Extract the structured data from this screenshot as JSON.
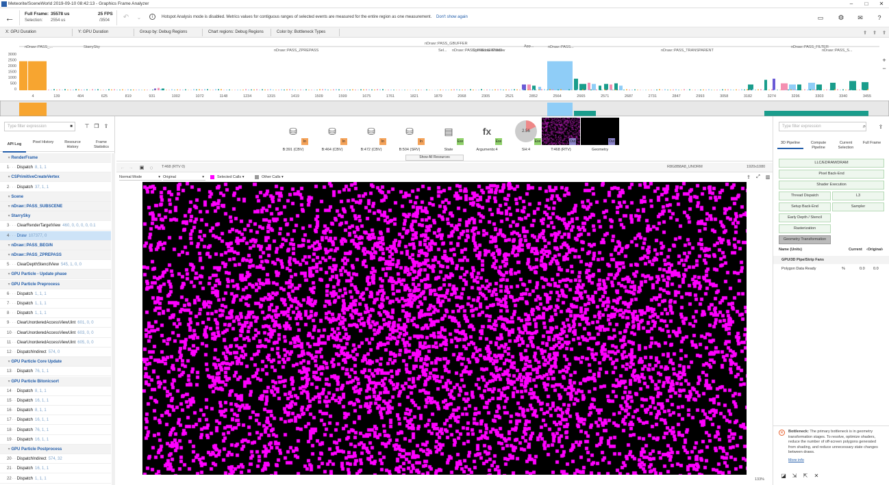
{
  "titlebar": {
    "title": "Meteorite/SceneWorld 2019-09-10 08:42:13 - Graphics Frame Analyzer"
  },
  "header": {
    "full_frame_label": "Full Frame:",
    "full_frame_value": "35578 us",
    "fps": "25 FPS",
    "selection_label": "Selection:",
    "selection_value": "2554 us",
    "selection_count": "/3504",
    "info_text": "Hotspot Analysis mode is disabled. Metrics values for contiguous ranges of selected events are measured for the entire region as one measurement.",
    "dont_show_again": "Don't show again"
  },
  "filters": [
    {
      "label": "X: GPU Duration"
    },
    {
      "label": "Y: GPU Duration"
    },
    {
      "label": "Group by: Debug Regions"
    },
    {
      "label": "Chart regions: Debug Regions"
    },
    {
      "label": "Color by: Bottleneck Types"
    }
  ],
  "timeline": {
    "y_ticks": [
      "3000",
      "2500",
      "2000",
      "1500",
      "1000",
      "500",
      "0"
    ],
    "x_ticks": [
      "4",
      "139",
      "404",
      "625",
      "819",
      "931",
      "1002",
      "1072",
      "1148",
      "1234",
      "1315",
      "1419",
      "1509",
      "1599",
      "1675",
      "1761",
      "1821",
      "1879",
      "2068",
      "2305",
      "2521",
      "2852",
      "2564",
      "2665",
      "2571",
      "2687",
      "2731",
      "2847",
      "2993",
      "3058",
      "3182",
      "3274",
      "3296",
      "3303",
      "3340",
      "3455"
    ],
    "region_labels": [
      "nDraw::PASS_...",
      "StarrySky",
      "nDraw::PASS_ZPREPASS",
      "nDraw::PASS_GBUFFER",
      "nDraw::PASS_PRELIGHTING",
      "Sel...",
      "Directional Shadow",
      "App...",
      "nDraw::PASS...",
      "nDraw::PASS_TRANSPARENT",
      "nDraw::PASS_FILTER",
      "nDraw::PASS_S..."
    ]
  },
  "left_panel": {
    "filter_placeholder": "Type filter expression",
    "tabs": [
      "API Log",
      "Pixel History",
      "Resource History",
      "Frame Statistics"
    ],
    "rows": [
      {
        "idx": "",
        "name": "RenderFrame",
        "params": "",
        "type": "group"
      },
      {
        "idx": "1",
        "name": "Dispatch",
        "params": "8, 1, 1",
        "type": "call"
      },
      {
        "idx": "",
        "name": "CSPrimitiveCreateVertex",
        "params": "",
        "type": "group"
      },
      {
        "idx": "2",
        "name": "Dispatch",
        "params": "37, 1, 1",
        "type": "call"
      },
      {
        "idx": "",
        "name": "Scene",
        "params": "",
        "type": "group"
      },
      {
        "idx": "",
        "name": "nDraw::PASS_SUBSCENE",
        "params": "",
        "type": "group"
      },
      {
        "idx": "",
        "name": "StarrySky",
        "params": "",
        "type": "group"
      },
      {
        "idx": "3",
        "name": "ClearRenderTargetView",
        "params": "460, 0, 0, 0, 0, 0.1",
        "type": "call"
      },
      {
        "idx": "4",
        "name": "Draw",
        "params": "107377, 0",
        "type": "selected"
      },
      {
        "idx": "",
        "name": "nDraw::PASS_BEGIN",
        "params": "",
        "type": "group"
      },
      {
        "idx": "",
        "name": "nDraw::PASS_ZPREPASS",
        "params": "",
        "type": "group"
      },
      {
        "idx": "5",
        "name": "ClearDepthStencilView",
        "params": "545, 1, 0, 0",
        "type": "call"
      },
      {
        "idx": "",
        "name": "GPU Particle - Update phase",
        "params": "",
        "type": "group"
      },
      {
        "idx": "",
        "name": "GPU Particle Preprocess",
        "params": "",
        "type": "group"
      },
      {
        "idx": "6",
        "name": "Dispatch",
        "params": "1, 1, 1",
        "type": "call"
      },
      {
        "idx": "7",
        "name": "Dispatch",
        "params": "1, 1, 1",
        "type": "call"
      },
      {
        "idx": "8",
        "name": "Dispatch",
        "params": "1, 1, 1",
        "type": "call"
      },
      {
        "idx": "9",
        "name": "ClearUnorderedAccessViewUint",
        "params": "601, 0, 0",
        "type": "call"
      },
      {
        "idx": "10",
        "name": "ClearUnorderedAccessViewUint",
        "params": "603, 0, 0",
        "type": "call"
      },
      {
        "idx": "11",
        "name": "ClearUnorderedAccessViewUint",
        "params": "605, 0, 0",
        "type": "call"
      },
      {
        "idx": "12",
        "name": "DispatchIndirect",
        "params": "574, 0",
        "type": "call"
      },
      {
        "idx": "",
        "name": "GPU Particle Core Update",
        "params": "",
        "type": "group"
      },
      {
        "idx": "13",
        "name": "Dispatch",
        "params": "76, 1, 1",
        "type": "call"
      },
      {
        "idx": "",
        "name": "GPU Particle Bitonicsort",
        "params": "",
        "type": "group"
      },
      {
        "idx": "14",
        "name": "Dispatch",
        "params": "8, 1, 1",
        "type": "call"
      },
      {
        "idx": "15",
        "name": "Dispatch",
        "params": "16, 1, 1",
        "type": "call"
      },
      {
        "idx": "16",
        "name": "Dispatch",
        "params": "8, 1, 1",
        "type": "call"
      },
      {
        "idx": "17",
        "name": "Dispatch",
        "params": "16, 1, 1",
        "type": "call"
      },
      {
        "idx": "18",
        "name": "Dispatch",
        "params": "76, 1, 1",
        "type": "call"
      },
      {
        "idx": "19",
        "name": "Dispatch",
        "params": "16, 1, 1",
        "type": "call"
      },
      {
        "idx": "",
        "name": "GPU Particle Postprocess",
        "params": "",
        "type": "group"
      },
      {
        "idx": "20",
        "name": "DispatchIndirect",
        "params": "574, 32",
        "type": "call"
      },
      {
        "idx": "21",
        "name": "Dispatch",
        "params": "16, 1, 1",
        "type": "call"
      },
      {
        "idx": "22",
        "name": "Dispatch",
        "params": "1, 1, 1",
        "type": "call"
      }
    ]
  },
  "resources": [
    {
      "label": "B:391 (CBV)",
      "tag": "In"
    },
    {
      "label": "B:464 (CBV)",
      "tag": "In"
    },
    {
      "label": "B:472 (CBV)",
      "tag": "In"
    },
    {
      "label": "B:504 (SRV)",
      "tag": "In"
    },
    {
      "label": "State",
      "tag": "Exe"
    },
    {
      "label": "Arguments:4",
      "tag": "Exe"
    },
    {
      "label": "SH:4",
      "tag": "Exe"
    },
    {
      "label": "T:468 (RTV)",
      "tag": "Out"
    },
    {
      "label": "Geometry",
      "tag": "Out"
    }
  ],
  "sh_value": "2.56",
  "show_all_resources": "Show All Resources",
  "viewer": {
    "texture_name": "T:468 (RTV 0)",
    "format": "R8G8B8A8_UNORM",
    "size": "1920x1080",
    "mode": "Normal Mode",
    "channel": "Original",
    "selected_calls": "Selected Calls",
    "other_calls": "Other Calls",
    "zoom": "133%"
  },
  "right_panel": {
    "filter_placeholder": "Type filter expression",
    "tabs": [
      "3D Pipeline",
      "Compute Pipeline",
      "Current Selection",
      "Full Frame"
    ],
    "pipeline": {
      "llc": "LLC/EDRAM/DRAM",
      "pixel_back_end": "Pixel Back-End",
      "shader_execution": "Shader Execution",
      "thread_dispatch": "Thread Dispatch",
      "l3": "L3",
      "setup_back_end": "Setup Back-End",
      "sampler": "Sampler",
      "early_depth": "Early Depth / Stencil",
      "rasterization": "Rasterization",
      "geometry_transformation": "Geometry Transformation"
    },
    "metrics_header": {
      "name": "Name (Units)",
      "current": "Current",
      "original": "Original"
    },
    "metrics_group": "GPU/3D Pipe/Strip Fans",
    "metrics": [
      {
        "name": "Polygon Data Ready",
        "unit": "%",
        "current": "0.0",
        "original": "0.0"
      }
    ],
    "bottleneck_title": "Bottleneck:",
    "bottleneck_text": "The primary bottleneck is in geometry transformation stages. To resolve, optimize shaders, reduce the number of off-screen polygons generated from shading, and reduce unnecessary state changes between draws.",
    "more_info": "More info"
  },
  "colors": {
    "accent": "#1e5aa8",
    "magenta": "#ff00ff",
    "orange": "#f7a530",
    "lightblue": "#8fcdf7",
    "teal": "#1a9d8c",
    "pink": "#f48fb1",
    "purple": "#6b5bd6"
  }
}
